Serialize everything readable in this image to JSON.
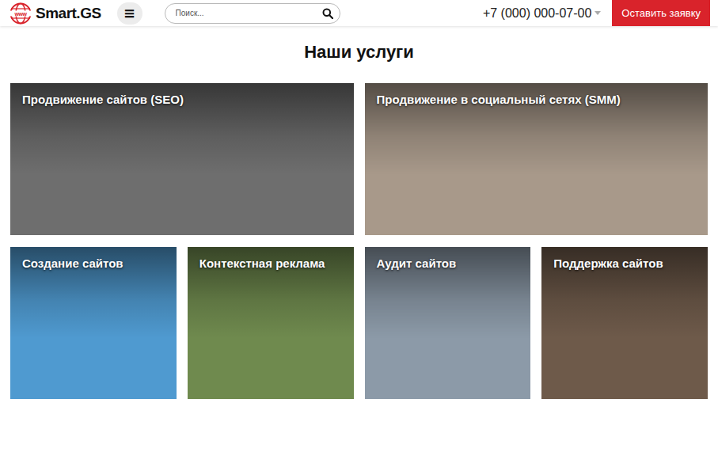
{
  "header": {
    "logo": {
      "globe_text": "www",
      "name": "Smart.GS"
    },
    "menu_button": "≡",
    "search": {
      "placeholder": "Поиск..."
    },
    "phone": "+7 (000) 000-07-00",
    "cta_button": "Оставить заявку"
  },
  "section": {
    "title": "Наши услуги"
  },
  "top_row": [
    {
      "title": "Продвижение сайтов (SEO)",
      "color": "#6e6e6e"
    },
    {
      "title": "Продвижение в социальный сетях (SMM)",
      "color": "#a8998a"
    }
  ],
  "bottom_row": [
    {
      "title": "Создание сайтов",
      "color": "#4f9ad0"
    },
    {
      "title": "Контекстная реклама",
      "color": "#6f8a4e"
    },
    {
      "title": "Аудит сайтов",
      "color": "#8c9aa8"
    },
    {
      "title": "Поддержка сайтов",
      "color": "#6e5a4a"
    }
  ]
}
